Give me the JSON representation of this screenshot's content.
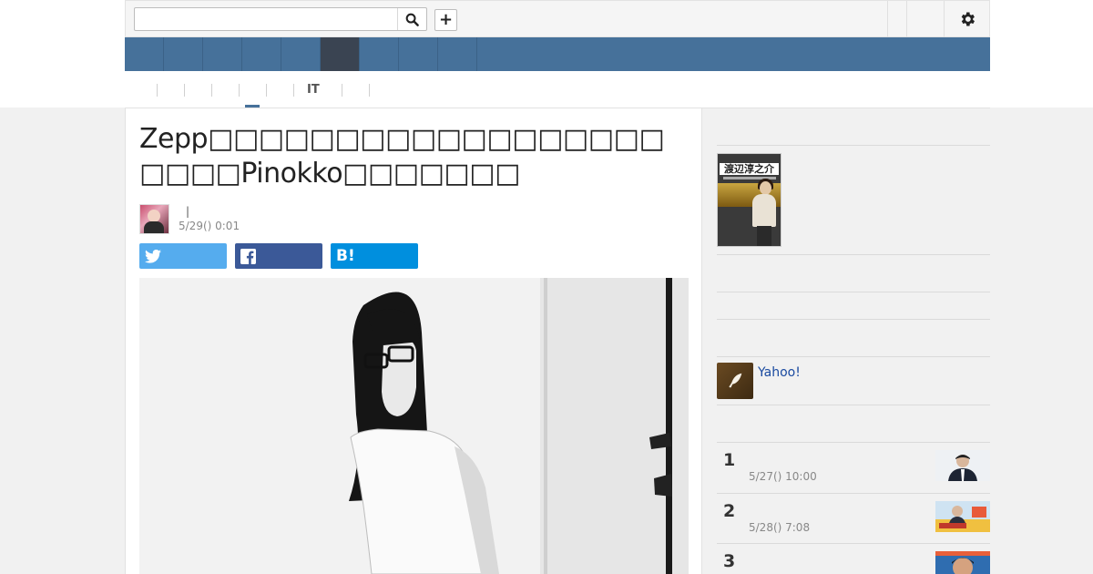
{
  "search": {
    "value": "",
    "placeholder": ""
  },
  "toolbar": {
    "plus_label": "+"
  },
  "nav": {
    "items": [
      {
        "label": "",
        "width": 42,
        "active": false
      },
      {
        "label": "",
        "width": 43,
        "active": false
      },
      {
        "label": "",
        "width": 43,
        "active": false
      },
      {
        "label": "",
        "width": 43,
        "active": false
      },
      {
        "label": "",
        "width": 43,
        "active": false
      },
      {
        "label": "",
        "width": 43,
        "active": true
      },
      {
        "label": "",
        "width": 43,
        "active": false
      },
      {
        "label": "",
        "width": 43,
        "active": false
      },
      {
        "label": "",
        "width": 43,
        "active": false
      }
    ]
  },
  "subnav": {
    "it_label": "IT"
  },
  "article": {
    "title": "Zepp□□□□□□□□□□□□□□□□□□□□□□Pinokko□□□□□□□",
    "byline_separator": "|",
    "date": "5/29() 0:01"
  },
  "side": {
    "book_title": "渡辺淳之介",
    "yahoo_link": "Yahoo!",
    "ranking": [
      {
        "rank": "1",
        "date": "5/27() 10:00"
      },
      {
        "rank": "2",
        "date": "5/28() 7:08"
      },
      {
        "rank": "3",
        "date": ""
      }
    ]
  },
  "colors": {
    "nav": "#46719a",
    "nav_active": "#3a4452",
    "twitter": "#55acee",
    "facebook": "#3b5998",
    "hatena": "#008fde",
    "link": "#1a4aa0"
  },
  "icons": [
    "search-icon",
    "plus-icon",
    "gear-icon",
    "twitter-icon",
    "facebook-icon",
    "hatena-bookmark-icon",
    "quill-icon"
  ]
}
